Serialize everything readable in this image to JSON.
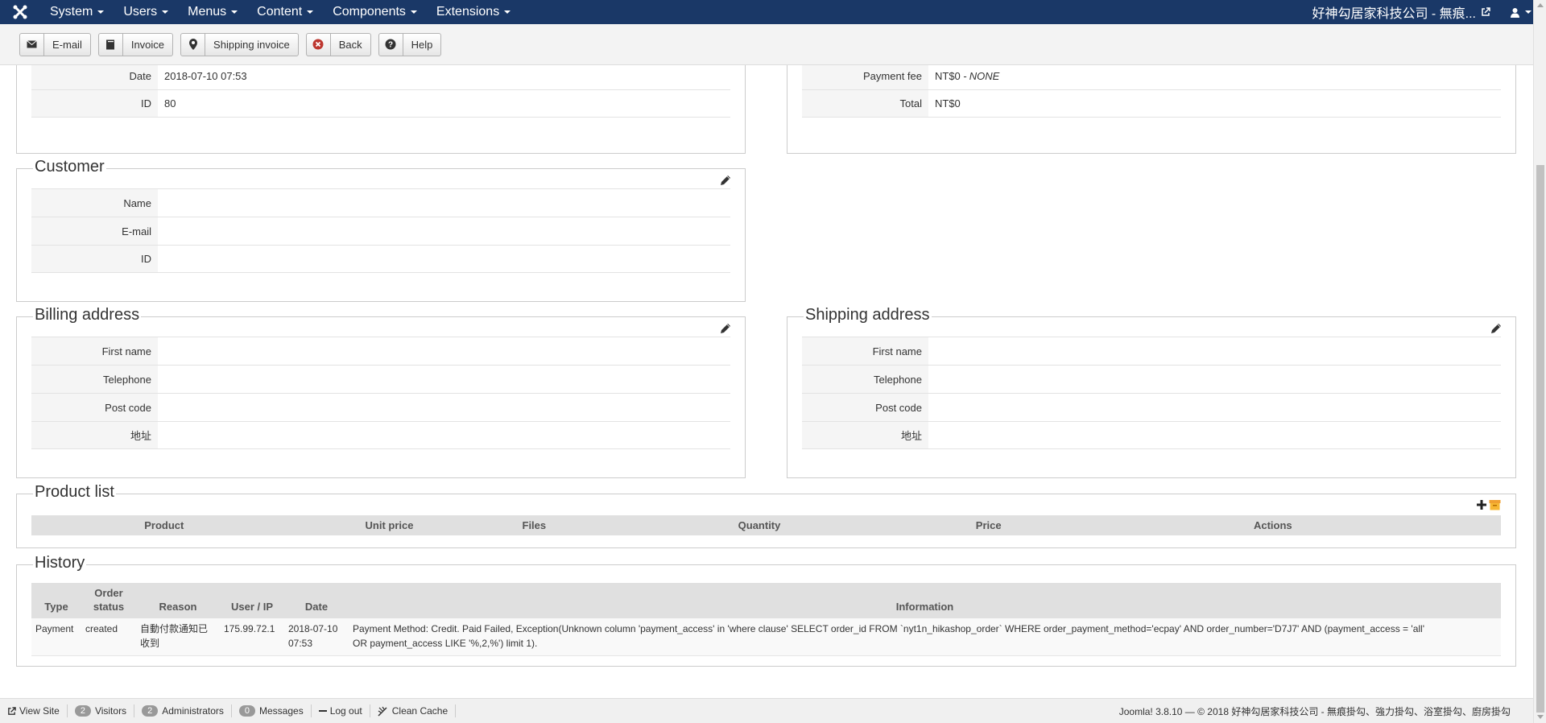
{
  "navbar": {
    "menus": [
      "System",
      "Users",
      "Menus",
      "Content",
      "Components",
      "Extensions"
    ],
    "site_name": "好神勾居家科技公司 - 無痕..."
  },
  "toolbar": {
    "email": "E-mail",
    "invoice": "Invoice",
    "shipping_invoice": "Shipping invoice",
    "back": "Back",
    "help": "Help"
  },
  "general": {
    "date_label": "Date",
    "date_value": "2018-07-10 07:53",
    "id_label": "ID",
    "id_value": "80"
  },
  "payment": {
    "fee_label": "Payment fee",
    "fee_value": "NT$0 - ",
    "fee_note": "NONE",
    "total_label": "Total",
    "total_value": "NT$0"
  },
  "customer": {
    "title": "Customer",
    "rows": [
      {
        "label": "Name",
        "value": ""
      },
      {
        "label": "E-mail",
        "value": ""
      },
      {
        "label": "ID",
        "value": ""
      }
    ]
  },
  "billing": {
    "title": "Billing address",
    "rows": [
      {
        "label": "First name",
        "value": ""
      },
      {
        "label": "Telephone",
        "value": ""
      },
      {
        "label": "Post code",
        "value": ""
      },
      {
        "label": "地址",
        "value": ""
      }
    ]
  },
  "shipping": {
    "title": "Shipping address",
    "rows": [
      {
        "label": "First name",
        "value": ""
      },
      {
        "label": "Telephone",
        "value": ""
      },
      {
        "label": "Post code",
        "value": ""
      },
      {
        "label": "地址",
        "value": ""
      }
    ]
  },
  "products": {
    "title": "Product list",
    "columns": [
      "Product",
      "Unit price",
      "Files",
      "Quantity",
      "Price",
      "Actions"
    ]
  },
  "history": {
    "title": "History",
    "columns": [
      "Type",
      "Order status",
      "Reason",
      "User / IP",
      "Date",
      "Information"
    ],
    "rows": [
      {
        "type": "Payment",
        "status": "created",
        "reason": "自動付款通知已收到",
        "ip": "175.99.72.1",
        "date": "2018-07-10 07:53",
        "info": "Payment Method: Credit. Paid Failed, Exception(Unknown column 'payment_access' in 'where clause' SELECT order_id FROM `nyt1n_hikashop_order` WHERE order_payment_method='ecpay' AND order_number='D7J7' AND (payment_access = 'all' OR payment_access LIKE '%,2,%') limit 1)."
      }
    ]
  },
  "footer": {
    "view_site": "View Site",
    "visitors_count": "2",
    "visitors": "Visitors",
    "admins_count": "2",
    "admins": "Administrators",
    "messages_count": "0",
    "messages": "Messages",
    "logout": "Log out",
    "clean_cache": "Clean Cache",
    "copyright": "Joomla! 3.8.10 — © 2018 好神勾居家科技公司 - 無痕掛勾、強力掛勾、浴室掛勾、廚房掛勾"
  }
}
